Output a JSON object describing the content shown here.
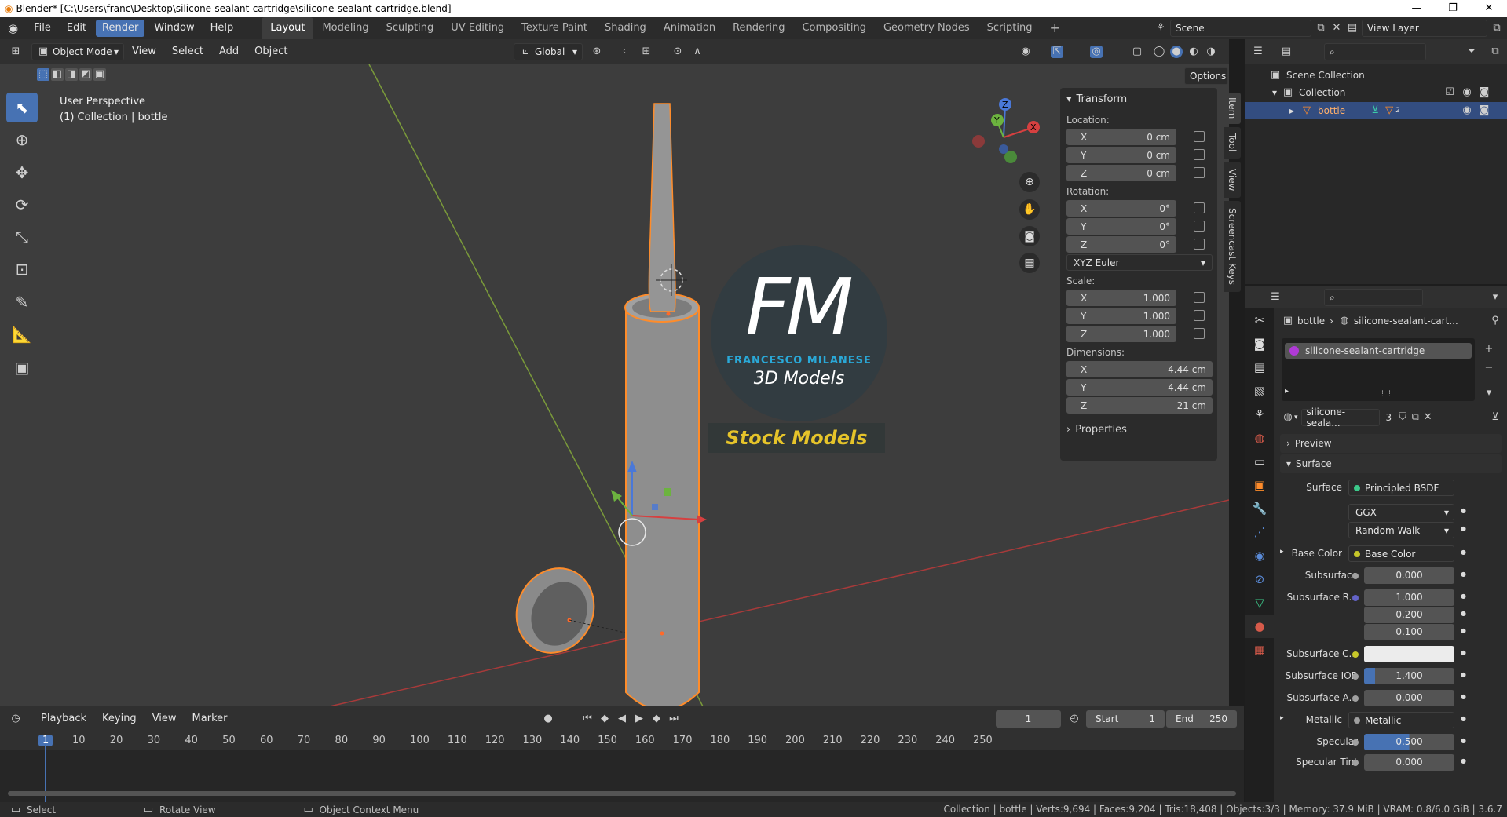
{
  "window": {
    "title": "Blender* [C:\\Users\\franc\\Desktop\\silicone-sealant-cartridge\\silicone-sealant-cartridge.blend]"
  },
  "menu": {
    "items": [
      "File",
      "Edit",
      "Render",
      "Window",
      "Help"
    ]
  },
  "workspaces": [
    "Layout",
    "Modeling",
    "Sculpting",
    "UV Editing",
    "Texture Paint",
    "Shading",
    "Animation",
    "Rendering",
    "Compositing",
    "Geometry Nodes",
    "Scripting"
  ],
  "scene": {
    "name": "Scene",
    "view_layer": "View Layer"
  },
  "viewport_header": {
    "mode": "Object Mode",
    "menus": [
      "View",
      "Select",
      "Add",
      "Object"
    ],
    "orientation": "Global",
    "options": "Options"
  },
  "viewport": {
    "perspective": "User Perspective",
    "collection_info": "(1) Collection | bottle"
  },
  "watermark": {
    "logo": "FM",
    "name": "FRANCESCO MILANESE",
    "sub": "3D Models",
    "banner": "Stock Models"
  },
  "npanel": {
    "title": "Transform",
    "location_label": "Location:",
    "location": [
      {
        "axis": "X",
        "value": "0 cm"
      },
      {
        "axis": "Y",
        "value": "0 cm"
      },
      {
        "axis": "Z",
        "value": "0 cm"
      }
    ],
    "rotation_label": "Rotation:",
    "rotation": [
      {
        "axis": "X",
        "value": "0°"
      },
      {
        "axis": "Y",
        "value": "0°"
      },
      {
        "axis": "Z",
        "value": "0°"
      }
    ],
    "rotation_mode": "XYZ Euler",
    "scale_label": "Scale:",
    "scale": [
      {
        "axis": "X",
        "value": "1.000"
      },
      {
        "axis": "Y",
        "value": "1.000"
      },
      {
        "axis": "Z",
        "value": "1.000"
      }
    ],
    "dimensions_label": "Dimensions:",
    "dimensions": [
      {
        "axis": "X",
        "value": "4.44 cm"
      },
      {
        "axis": "Y",
        "value": "4.44 cm"
      },
      {
        "axis": "Z",
        "value": "21 cm"
      }
    ],
    "properties": "Properties",
    "tabs": [
      "Item",
      "Tool",
      "View",
      "Screencast Keys"
    ]
  },
  "outliner": {
    "root": "Scene Collection",
    "collection": "Collection",
    "object": "bottle",
    "badge": "2"
  },
  "properties": {
    "breadcrumb_object": "bottle",
    "breadcrumb_material": "silicone-sealant-cart...",
    "slot": "silicone-sealant-cartridge",
    "material_name": "silicone-seala...",
    "users": "3",
    "preview": "Preview",
    "surface_section": "Surface",
    "surface_label": "Surface",
    "surface_value": "Principled BSDF",
    "distribution": "GGX",
    "subsurface_method": "Random Walk",
    "rows": [
      {
        "label": "Base Color",
        "value": "Base Color"
      },
      {
        "label": "Subsurface",
        "value": "0.000"
      },
      {
        "label": "Subsurface R...",
        "value": "1.000"
      },
      {
        "label": "",
        "value": "0.200"
      },
      {
        "label": "",
        "value": "0.100"
      },
      {
        "label": "Subsurface C...",
        "value": ""
      },
      {
        "label": "Subsurface IOR",
        "value": "1.400"
      },
      {
        "label": "Subsurface A...",
        "value": "0.000"
      },
      {
        "label": "Metallic",
        "value": "Metallic"
      },
      {
        "label": "Specular",
        "value": "0.500"
      },
      {
        "label": "Specular Tint",
        "value": "0.000"
      }
    ]
  },
  "timeline": {
    "menus": [
      "Playback",
      "Keying",
      "View",
      "Marker"
    ],
    "current_frame": "1",
    "start_label": "Start",
    "start": "1",
    "end_label": "End",
    "end": "250",
    "ruler": [
      "1",
      "10",
      "20",
      "30",
      "40",
      "50",
      "60",
      "70",
      "80",
      "90",
      "100",
      "110",
      "120",
      "130",
      "140",
      "150",
      "160",
      "170",
      "180",
      "190",
      "200",
      "210",
      "220",
      "230",
      "240",
      "250"
    ]
  },
  "status": {
    "select": "Select",
    "rotate": "Rotate View",
    "context": "Object Context Menu",
    "stats": "Collection | bottle | Verts:9,694 | Faces:9,204 | Tris:18,408 | Objects:3/3 | Memory: 37.9 MiB | VRAM: 0.8/6.0 GiB | 3.6.7"
  }
}
